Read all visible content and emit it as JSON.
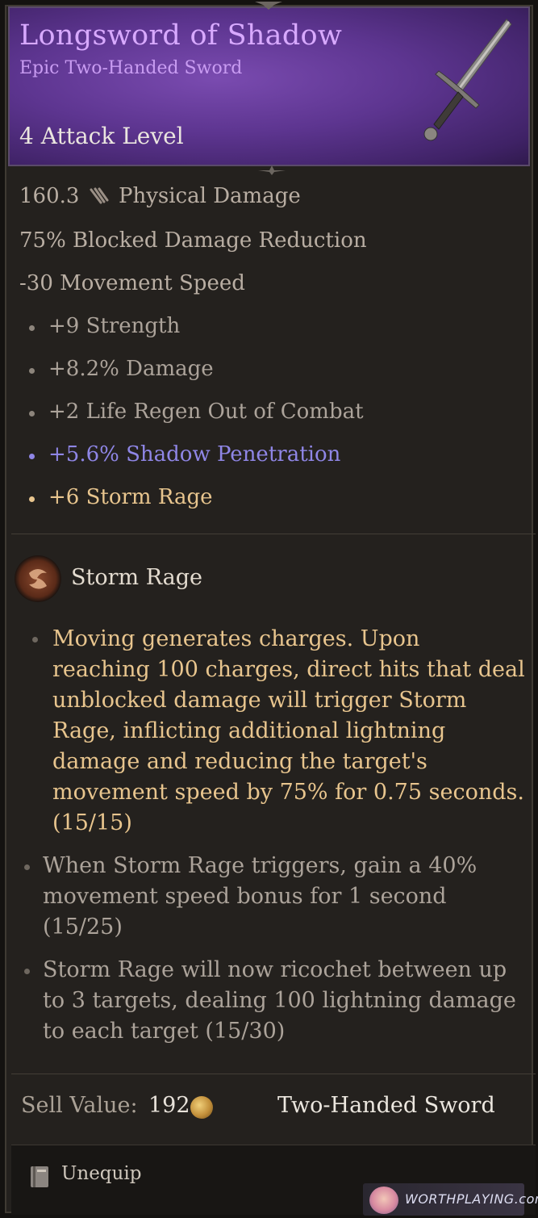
{
  "item": {
    "name": "Longsword of Shadow",
    "rarity_type": "Epic Two-Handed Sword",
    "attack_level": "4 Attack Level"
  },
  "stats": {
    "physical_damage_value": "160.3",
    "physical_damage_label": "Physical Damage",
    "blocked_reduction": "75% Blocked Damage Reduction",
    "movement_speed": "-30 Movement Speed",
    "affixes": [
      "+9 Strength",
      "+8.2% Damage",
      "+2 Life Regen Out of Combat",
      "+5.6% Shadow Penetration",
      "+6 Storm Rage"
    ]
  },
  "skill": {
    "name": "Storm Rage",
    "descriptions": [
      "Moving generates charges. Upon reaching 100 charges, direct hits that deal unblocked damage will trigger Storm Rage, inflicting additional lightning damage and reducing the target's movement speed by 75% for 0.75 seconds. (15/15)",
      "When Storm Rage triggers, gain a 40% movement speed bonus for 1 second (15/25)",
      "Storm Rage will now ricochet between up to 3 targets, dealing 100 lightning damage to each target (15/30)"
    ],
    "desc_lines": [
      [
        "Moving generates charges. Upon",
        "reaching 100 charges, direct hits that deal",
        "unblocked damage will trigger Storm",
        "Rage, inflicting additional lightning",
        "damage and reducing the target's",
        "movement speed by 75% for 0.75 seconds.",
        "(15/15)"
      ],
      [
        "When Storm Rage triggers, gain a 40%",
        "movement speed bonus for 1 second",
        "(15/25)"
      ],
      [
        "Storm Rage will now ricochet between up",
        "to 3 targets, dealing 100 lightning damage",
        "to each target (15/30)"
      ]
    ]
  },
  "footer": {
    "sell_label": "Sell Value:",
    "sell_value": "192",
    "item_type": "Two-Handed Sword",
    "unequip_label": "Unequip"
  },
  "watermark": {
    "text": "WORTHPLAYING.com"
  },
  "icons": {
    "damage": "claw-slash-icon",
    "skill": "storm-rage-icon",
    "currency": "gold-coin-icon",
    "unequip": "book-unequip-icon",
    "item": "longsword-icon"
  },
  "colors": {
    "epic_title": "#d8a9ff",
    "shadow_affix": "#8f86e6",
    "gold_affix": "#e8c58e",
    "base_text": "#b9aea3"
  }
}
